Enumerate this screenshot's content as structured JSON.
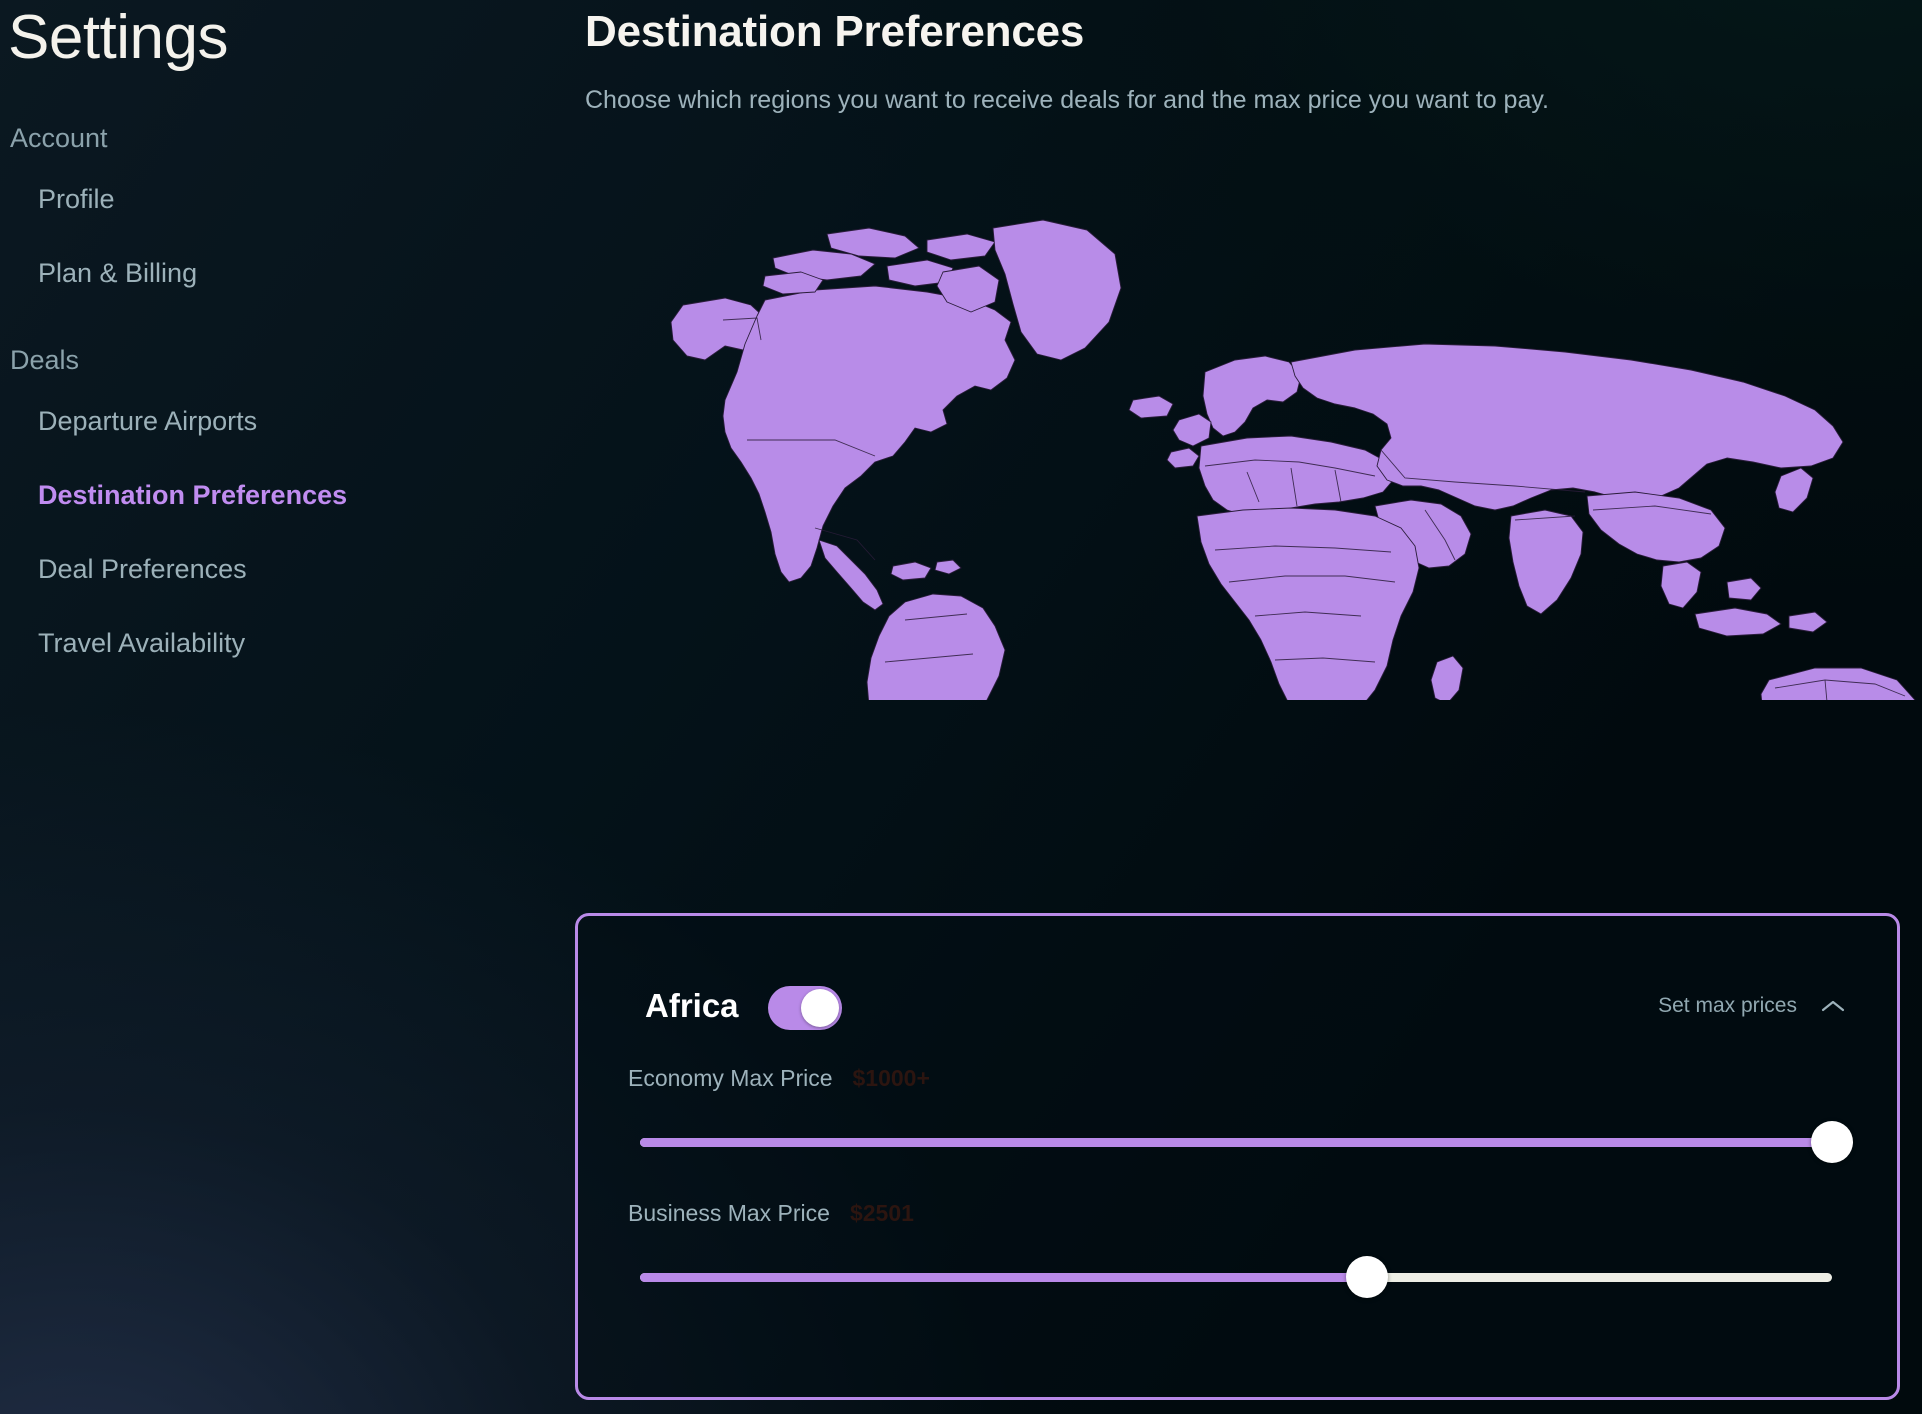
{
  "app": {
    "accent_purple": "#b98ae8",
    "active_nav_color": "#c08cf0",
    "background": "#020c10",
    "muted_text": "#9db2bb"
  },
  "sidebar": {
    "title": "Settings",
    "groups": [
      {
        "label": "Account",
        "items": [
          {
            "label": "Profile",
            "active": false
          },
          {
            "label": "Plan & Billing",
            "active": false
          }
        ]
      },
      {
        "label": "Deals",
        "items": [
          {
            "label": "Departure Airports",
            "active": false
          },
          {
            "label": "Destination Preferences",
            "active": true
          },
          {
            "label": "Deal Preferences",
            "active": false
          },
          {
            "label": "Travel Availability",
            "active": false
          }
        ]
      }
    ]
  },
  "main": {
    "title": "Destination Preferences",
    "subtitle": "Choose which regions you want to receive deals for and the max price you want to pay.",
    "map": {
      "land_color": "#b88ce8",
      "border_color": "#2a1c3a",
      "ocean_color": "#030f14"
    }
  },
  "region_card": {
    "region": "Africa",
    "enabled": true,
    "set_max_prices_label": "Set max prices",
    "expanded": true,
    "chevron_icon": "chevron-up-icon",
    "sliders": [
      {
        "label": "Economy Max Price",
        "value": "$1000+",
        "percent": 100
      },
      {
        "label": "Business Max Price",
        "value": "$2501",
        "percent": 61
      }
    ]
  }
}
